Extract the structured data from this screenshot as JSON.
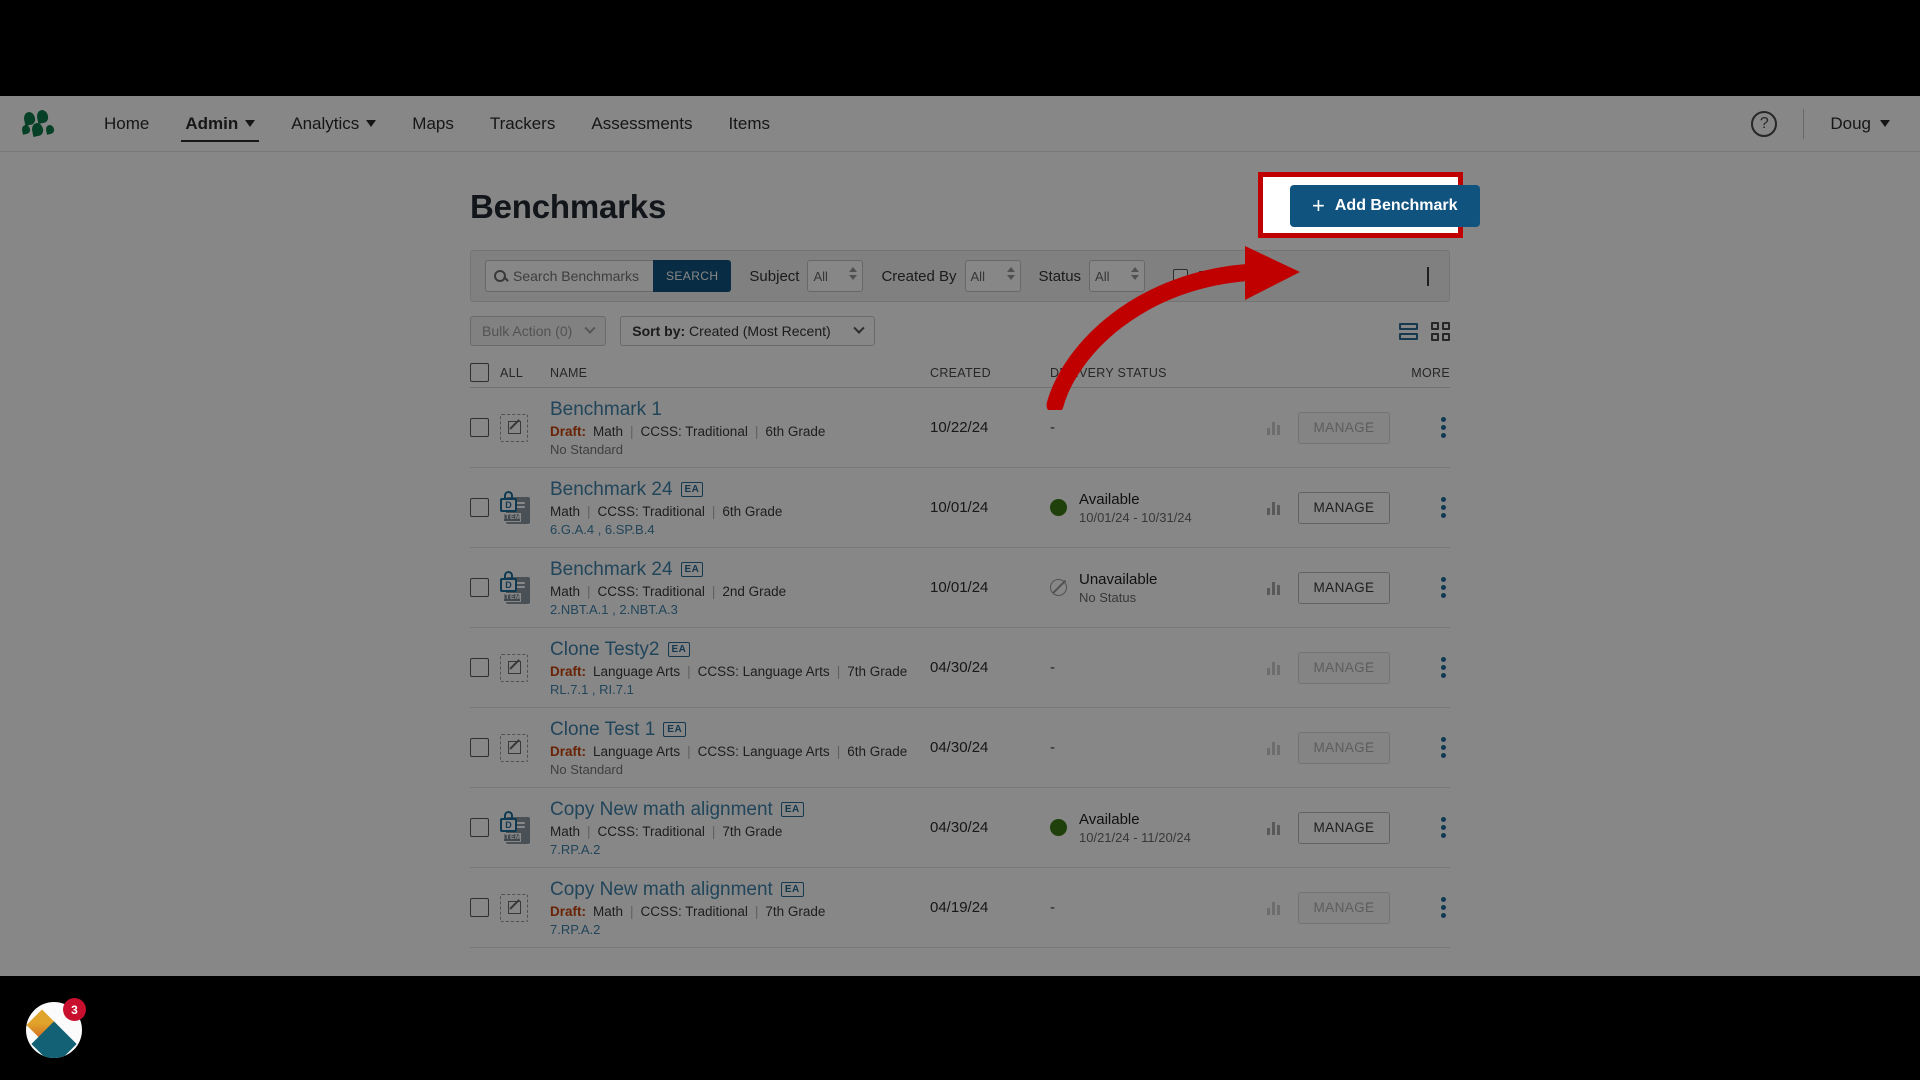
{
  "nav": {
    "logo_name": "company-logo",
    "links": [
      {
        "label": "Home",
        "has_caret": false,
        "active": false
      },
      {
        "label": "Admin",
        "has_caret": true,
        "active": true
      },
      {
        "label": "Analytics",
        "has_caret": true,
        "active": false
      },
      {
        "label": "Maps",
        "has_caret": false,
        "active": false
      },
      {
        "label": "Trackers",
        "has_caret": false,
        "active": false
      },
      {
        "label": "Assessments",
        "has_caret": false,
        "active": false
      },
      {
        "label": "Items",
        "has_caret": false,
        "active": false
      }
    ],
    "help_glyph": "?",
    "user": "Doug"
  },
  "header": {
    "title": "Benchmarks",
    "add_button": "Add Benchmark",
    "add_button_plus": "+",
    "add_button_color": "#10537f",
    "highlight_color": "#c00000"
  },
  "filters": {
    "search_placeholder": "Search Benchmarks",
    "search_value": "",
    "search_button": "SEARCH",
    "subject_label": "Subject",
    "subject_value": "All",
    "created_by_label": "Created By",
    "created_by_value": "All",
    "status_label": "Status",
    "status_value": "All",
    "drafts_only_label": "Drafts Only",
    "drafts_only_checked": false
  },
  "toolbar": {
    "bulk_action": "Bulk Action (0)",
    "sort_prefix": "Sort by:",
    "sort_value": "Created (Most Recent)",
    "view_list": "list-view",
    "view_grid": "grid-view"
  },
  "table": {
    "columns": {
      "all": "ALL",
      "name": "NAME",
      "created": "CREATED",
      "delivery_status": "DELIVERY STATUS",
      "more": "MORE"
    },
    "rows": [
      {
        "name": "Benchmark 1",
        "badge": "",
        "icon": "draft-pencil-icon",
        "draft_label": "Draft:",
        "subject": "Math",
        "framework": "CCSS: Traditional",
        "grade": "6th Grade",
        "standards": "No Standard",
        "standards_is_none": true,
        "created": "10/22/24",
        "status_type": "none",
        "status_main": "-",
        "status_sub": "",
        "manage": "MANAGE",
        "manage_disabled": true
      },
      {
        "name": "Benchmark 24",
        "badge": "EA",
        "icon": "locked-item-icon",
        "draft_label": "",
        "subject": "Math",
        "framework": "CCSS: Traditional",
        "grade": "6th Grade",
        "standards": "6.G.A.4 , 6.SP.B.4",
        "standards_is_none": false,
        "created": "10/01/24",
        "status_type": "available",
        "status_main": "Available",
        "status_sub": "10/01/24 - 10/31/24",
        "manage": "MANAGE",
        "manage_disabled": false
      },
      {
        "name": "Benchmark 24",
        "badge": "EA",
        "icon": "locked-item-icon",
        "draft_label": "",
        "subject": "Math",
        "framework": "CCSS: Traditional",
        "grade": "2nd Grade",
        "standards": "2.NBT.A.1 , 2.NBT.A.3",
        "standards_is_none": false,
        "created": "10/01/24",
        "status_type": "unavailable",
        "status_main": "Unavailable",
        "status_sub": "No Status",
        "manage": "MANAGE",
        "manage_disabled": false
      },
      {
        "name": "Clone Testy2",
        "badge": "EA",
        "icon": "draft-pencil-icon",
        "draft_label": "Draft:",
        "subject": "Language Arts",
        "framework": "CCSS: Language Arts",
        "grade": "7th Grade",
        "standards": "RL.7.1 , RI.7.1",
        "standards_is_none": false,
        "created": "04/30/24",
        "status_type": "none",
        "status_main": "-",
        "status_sub": "",
        "manage": "MANAGE",
        "manage_disabled": true
      },
      {
        "name": "Clone Test 1",
        "badge": "EA",
        "icon": "draft-pencil-icon",
        "draft_label": "Draft:",
        "subject": "Language Arts",
        "framework": "CCSS: Language Arts",
        "grade": "6th Grade",
        "standards": "No Standard",
        "standards_is_none": true,
        "created": "04/30/24",
        "status_type": "none",
        "status_main": "-",
        "status_sub": "",
        "manage": "MANAGE",
        "manage_disabled": true
      },
      {
        "name": "Copy New math alignment",
        "badge": "EA",
        "icon": "locked-item-icon",
        "draft_label": "",
        "subject": "Math",
        "framework": "CCSS: Traditional",
        "grade": "7th Grade",
        "standards": "7.RP.A.2",
        "standards_is_none": false,
        "created": "04/30/24",
        "status_type": "available",
        "status_main": "Available",
        "status_sub": "10/21/24 - 11/20/24",
        "manage": "MANAGE",
        "manage_disabled": false
      },
      {
        "name": "Copy New math alignment",
        "badge": "EA",
        "icon": "draft-pencil-icon",
        "draft_label": "Draft:",
        "subject": "Math",
        "framework": "CCSS: Traditional",
        "grade": "7th Grade",
        "standards": "7.RP.A.2",
        "standards_is_none": false,
        "created": "04/19/24",
        "status_type": "none",
        "status_main": "-",
        "status_sub": "",
        "manage": "MANAGE",
        "manage_disabled": true
      }
    ]
  },
  "widget": {
    "badge_count": "3",
    "name": "help-widget"
  }
}
